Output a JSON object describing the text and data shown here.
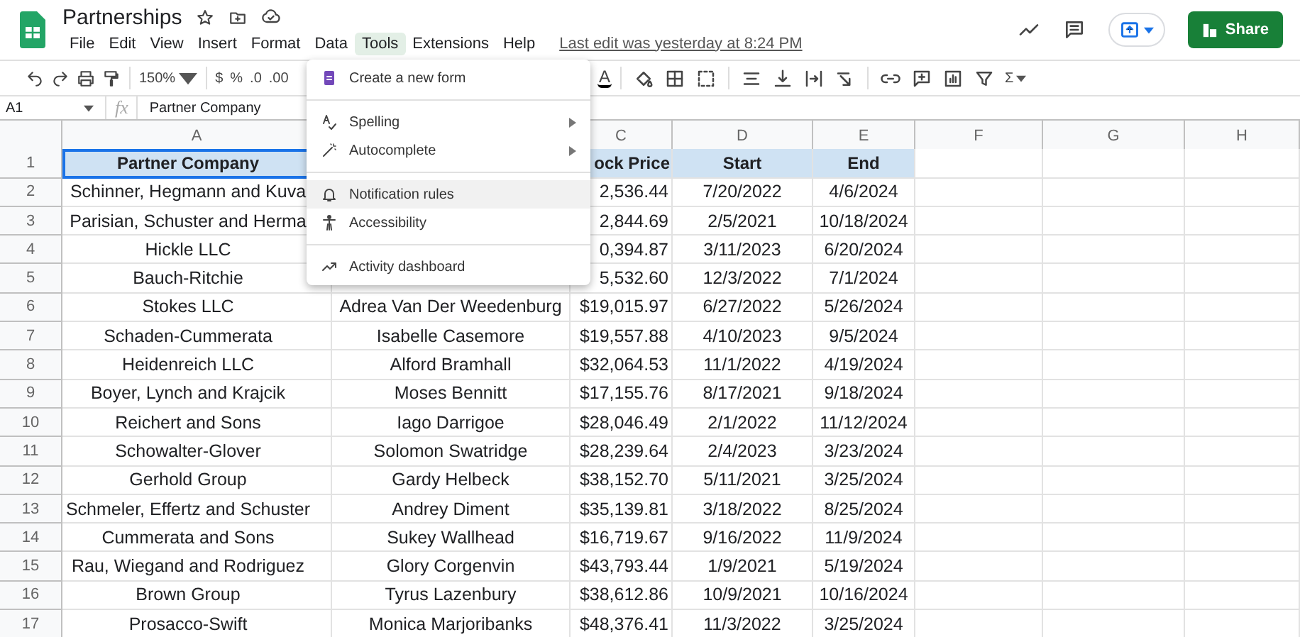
{
  "document": {
    "title": "Partnerships",
    "last_edit": "Last edit was yesterday at 8:24 PM"
  },
  "menu_bar": [
    {
      "label": "File",
      "selected": false
    },
    {
      "label": "Edit",
      "selected": false
    },
    {
      "label": "View",
      "selected": false
    },
    {
      "label": "Insert",
      "selected": false
    },
    {
      "label": "Format",
      "selected": false
    },
    {
      "label": "Data",
      "selected": false
    },
    {
      "label": "Tools",
      "selected": true
    },
    {
      "label": "Extensions",
      "selected": false
    },
    {
      "label": "Help",
      "selected": false
    }
  ],
  "share_button": "Share",
  "toolbar": {
    "zoom": "150%",
    "currency": "$",
    "percent": "%",
    "decrease_decimals": ".0",
    "increase_decimals": ".00",
    "text_color": "A",
    "sum": "Σ"
  },
  "formula_bar": {
    "cell": "A1",
    "fx": "fx",
    "value": "Partner Company"
  },
  "column_headers": [
    "A",
    "C",
    "D",
    "E",
    "F",
    "G",
    "H"
  ],
  "rows": [
    {
      "number": "1",
      "header": true,
      "company": "Partner Company",
      "price": "ock Price",
      "start": "Start",
      "end": "End"
    },
    {
      "number": "2",
      "header": false,
      "company": "Schinner, Hegmann and Kuva",
      "price": "2,536.44",
      "start": "7/20/2022",
      "end": "4/6/2024"
    },
    {
      "number": "3",
      "header": false,
      "company": "Parisian, Schuster and Herma",
      "price": "2,844.69",
      "start": "2/5/2021",
      "end": "10/18/2024"
    },
    {
      "number": "4",
      "header": false,
      "company": "Hickle LLC",
      "price": "0,394.87",
      "start": "3/11/2023",
      "end": "6/20/2024"
    },
    {
      "number": "5",
      "header": false,
      "company": "Bauch-Ritchie",
      "price": "5,532.60",
      "start": "12/3/2022",
      "end": "7/1/2024"
    },
    {
      "number": "6",
      "header": false,
      "company": "Stokes LLC",
      "contact": "Adrea Van Der Weedenburg",
      "price": "$19,015.97",
      "start": "6/27/2022",
      "end": "5/26/2024"
    },
    {
      "number": "7",
      "header": false,
      "company": "Schaden-Cummerata",
      "contact": "Isabelle Casemore",
      "price": "$19,557.88",
      "start": "4/10/2023",
      "end": "9/5/2024"
    },
    {
      "number": "8",
      "header": false,
      "company": "Heidenreich LLC",
      "contact": "Alford Bramhall",
      "price": "$32,064.53",
      "start": "11/1/2022",
      "end": "4/19/2024"
    },
    {
      "number": "9",
      "header": false,
      "company": "Boyer, Lynch and Krajcik",
      "contact": "Moses Bennitt",
      "price": "$17,155.76",
      "start": "8/17/2021",
      "end": "9/18/2024"
    },
    {
      "number": "10",
      "header": false,
      "company": "Reichert and Sons",
      "contact": "Iago Darrigoe",
      "price": "$28,046.49",
      "start": "2/1/2022",
      "end": "11/12/2024"
    },
    {
      "number": "11",
      "header": false,
      "company": "Schowalter-Glover",
      "contact": "Solomon Swatridge",
      "price": "$28,239.64",
      "start": "2/4/2023",
      "end": "3/23/2024"
    },
    {
      "number": "12",
      "header": false,
      "company": "Gerhold Group",
      "contact": "Gardy Helbeck",
      "price": "$38,152.70",
      "start": "5/11/2021",
      "end": "3/25/2024"
    },
    {
      "number": "13",
      "header": false,
      "company": "Schmeler, Effertz and Schuster",
      "contact": "Andrey Diment",
      "price": "$35,139.81",
      "start": "3/18/2022",
      "end": "8/25/2024"
    },
    {
      "number": "14",
      "header": false,
      "company": "Cummerata and Sons",
      "contact": "Sukey Wallhead",
      "price": "$16,719.67",
      "start": "9/16/2022",
      "end": "11/9/2024"
    },
    {
      "number": "15",
      "header": false,
      "company": "Rau, Wiegand and Rodriguez",
      "contact": "Glory Corgenvin",
      "price": "$43,793.44",
      "start": "1/9/2021",
      "end": "5/19/2024"
    },
    {
      "number": "16",
      "header": false,
      "company": "Brown Group",
      "contact": "Tyrus Lazenbury",
      "price": "$38,612.86",
      "start": "10/9/2021",
      "end": "10/16/2024"
    },
    {
      "number": "17",
      "header": false,
      "company": "Prosacco-Swift",
      "contact": "Monica Marjoribanks",
      "price": "$48,376.41",
      "start": "11/3/2022",
      "end": "3/25/2024"
    }
  ],
  "tools_menu": [
    [
      {
        "label": "Create a new form",
        "submenu": false,
        "highlighted": false
      }
    ],
    [
      {
        "label": "Spelling",
        "submenu": true,
        "highlighted": false
      },
      {
        "label": "Autocomplete",
        "submenu": true,
        "highlighted": false
      }
    ],
    [
      {
        "label": "Notification rules",
        "submenu": false,
        "highlighted": true
      },
      {
        "label": "Accessibility",
        "submenu": false,
        "highlighted": false
      }
    ],
    [
      {
        "label": "Activity dashboard",
        "submenu": false,
        "highlighted": false
      }
    ]
  ]
}
